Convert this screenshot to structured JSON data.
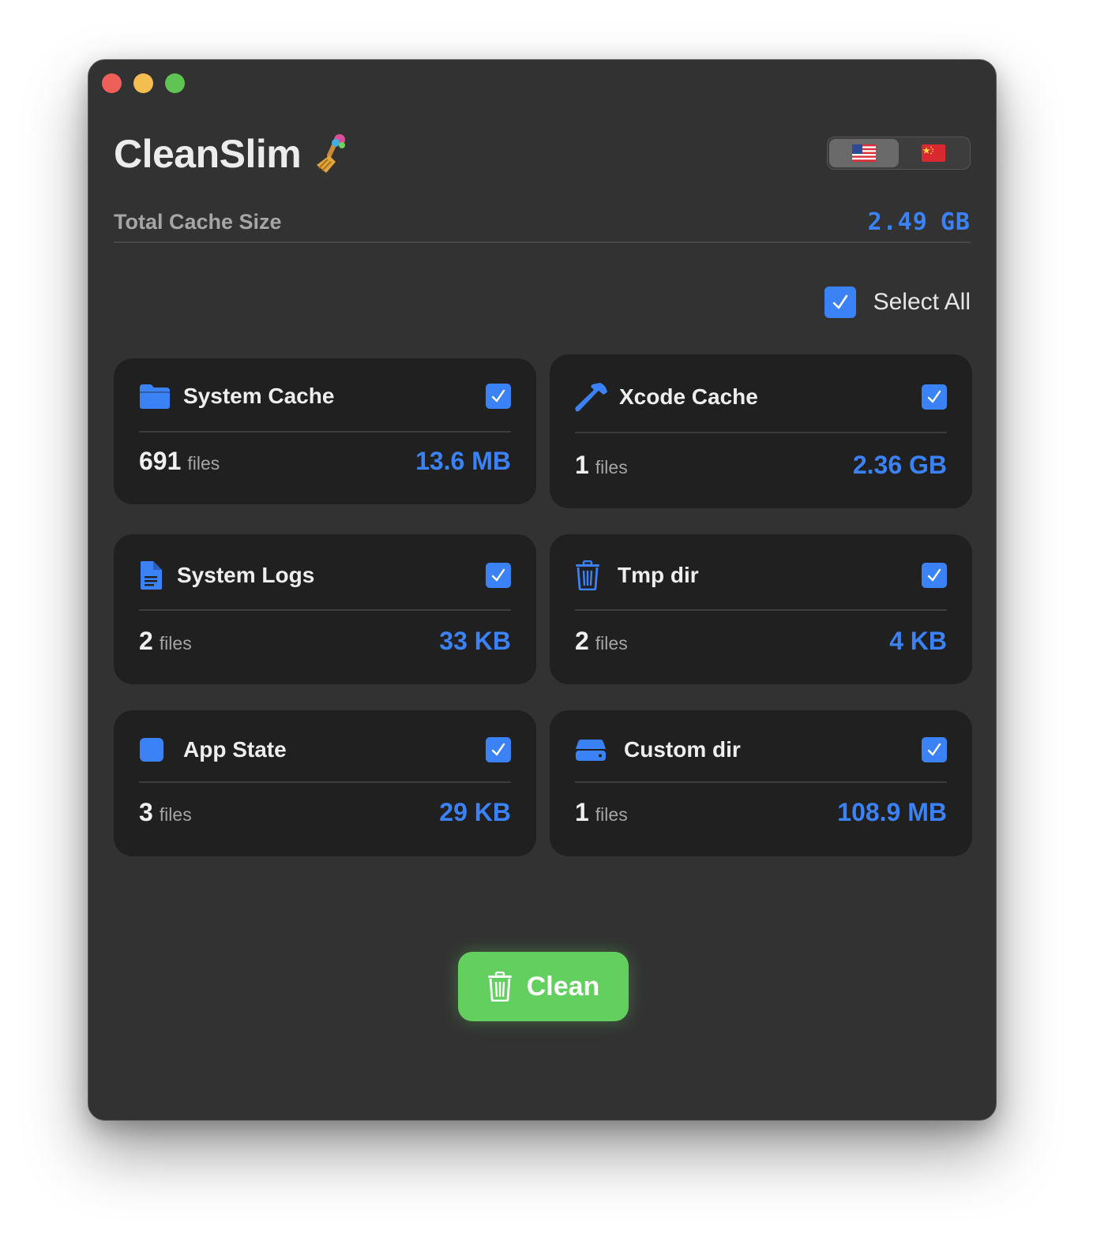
{
  "app": {
    "title": "CleanSlim",
    "title_icon": "broom-emoji"
  },
  "language": {
    "options": [
      {
        "name": "English",
        "icon": "us-flag-icon",
        "selected": true
      },
      {
        "name": "Chinese",
        "icon": "china-flag-icon",
        "selected": false
      }
    ]
  },
  "total": {
    "label": "Total Cache Size",
    "value": "2.49",
    "unit": "GB"
  },
  "select_all": {
    "label": "Select All",
    "checked": true
  },
  "cards": [
    {
      "title": "System Cache",
      "icon": "folder-icon",
      "count": "691",
      "files_label": "files",
      "size": "13.6 MB",
      "checked": true
    },
    {
      "title": "Xcode Cache",
      "icon": "hammer-icon",
      "count": "1",
      "files_label": "files",
      "size": "2.36 GB",
      "checked": true
    },
    {
      "title": "System Logs",
      "icon": "document-icon",
      "count": "2",
      "files_label": "files",
      "size": "33 KB",
      "checked": true
    },
    {
      "title": "Tmp dir",
      "icon": "trash-icon",
      "count": "2",
      "files_label": "files",
      "size": "4 KB",
      "checked": true
    },
    {
      "title": "App State",
      "icon": "square-icon",
      "count": "3",
      "files_label": "files",
      "size": "29 KB",
      "checked": true
    },
    {
      "title": "Custom dir",
      "icon": "drive-icon",
      "count": "1",
      "files_label": "files",
      "size": "108.9 MB",
      "checked": true
    }
  ],
  "actions": {
    "clean_label": "Clean",
    "clean_icon": "trash-icon"
  },
  "colors": {
    "accent": "#3b82f6",
    "clean_button": "#63cf5f",
    "window_bg": "#323232",
    "card_bg": "#202020"
  }
}
